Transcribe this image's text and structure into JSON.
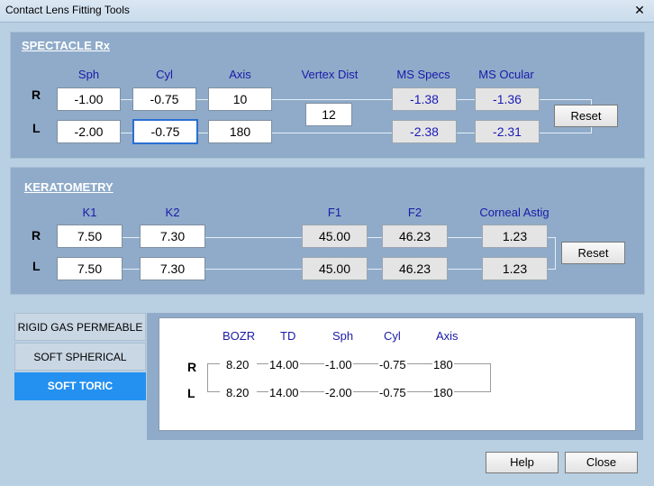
{
  "window": {
    "title": "Contact Lens Fitting Tools",
    "close_glyph": "✕"
  },
  "spectacle": {
    "title": "SPECTACLE Rx",
    "headers": {
      "sph": "Sph",
      "cyl": "Cyl",
      "axis": "Axis",
      "vertex": "Vertex Dist",
      "ms_specs": "MS Specs",
      "ms_ocular": "MS Ocular"
    },
    "rows": [
      {
        "label": "R",
        "sph": "-1.00",
        "cyl": "-0.75",
        "axis": "10",
        "ms_specs": "-1.38",
        "ms_ocular": "-1.36"
      },
      {
        "label": "L",
        "sph": "-2.00",
        "cyl": "-0.75",
        "axis": "180",
        "ms_specs": "-2.38",
        "ms_ocular": "-2.31"
      }
    ],
    "vertex_dist": "12",
    "reset_label": "Reset"
  },
  "keratometry": {
    "title": "KERATOMETRY",
    "headers": {
      "k1": "K1",
      "k2": "K2",
      "f1": "F1",
      "f2": "F2",
      "astig": "Corneal Astig"
    },
    "rows": [
      {
        "label": "R",
        "k1": "7.50",
        "k2": "7.30",
        "f1": "45.00",
        "f2": "46.23",
        "astig": "1.23"
      },
      {
        "label": "L",
        "k1": "7.50",
        "k2": "7.30",
        "f1": "45.00",
        "f2": "46.23",
        "astig": "1.23"
      }
    ],
    "reset_label": "Reset"
  },
  "lens_tabs": [
    {
      "label": "RIGID GAS PERMEABLE",
      "active": false
    },
    {
      "label": "SOFT SPHERICAL",
      "active": false
    },
    {
      "label": "SOFT TORIC",
      "active": true
    }
  ],
  "result": {
    "headers": {
      "bozr": "BOZR",
      "td": "TD",
      "sph": "Sph",
      "cyl": "Cyl",
      "axis": "Axis"
    },
    "rows": [
      {
        "label": "R",
        "bozr": "8.20",
        "td": "14.00",
        "sph": "-1.00",
        "cyl": "-0.75",
        "axis": "180"
      },
      {
        "label": "L",
        "bozr": "8.20",
        "td": "14.00",
        "sph": "-2.00",
        "cyl": "-0.75",
        "axis": "180"
      }
    ]
  },
  "footer": {
    "help_label": "Help",
    "close_label": "Close"
  }
}
